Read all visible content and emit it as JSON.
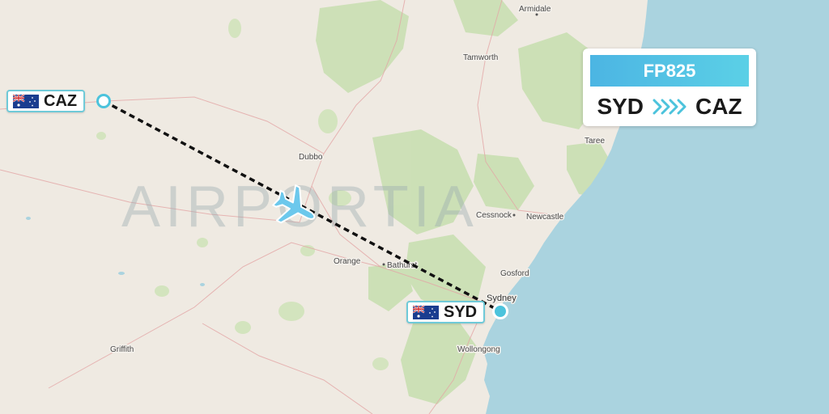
{
  "flight": {
    "number": "FP825",
    "origin": "SYD",
    "destination": "CAZ",
    "route_icon": "chevrons-right-icon"
  },
  "airports": {
    "origin": {
      "code": "SYD",
      "flag": "australia-flag"
    },
    "destination": {
      "code": "CAZ",
      "flag": "australia-flag"
    }
  },
  "map": {
    "watermark": "AIRPORTIA",
    "places": {
      "armidale": "Armidale",
      "tamworth": "Tamworth",
      "taree": "Taree",
      "dubbo": "Dubbo",
      "cessnock": "Cessnock",
      "newcastle": "Newcastle",
      "orange": "Orange",
      "bathurst": "Bathurst",
      "gosford": "Gosford",
      "sydney": "Sydney",
      "griffith": "Griffith",
      "wollongong": "Wollongong"
    },
    "plane_icon": "airplane-icon"
  },
  "colors": {
    "accent": "#4cb5e3",
    "route_line": "#111111",
    "airport_marker": "#4cc3dc",
    "ocean": "#aad3df",
    "land": "#efeae2",
    "forest": "#c8dfb0"
  }
}
